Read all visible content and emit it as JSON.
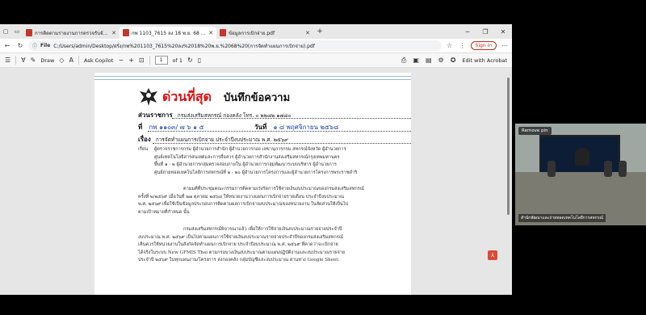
{
  "browser": {
    "tabs": [
      {
        "title": "การติดตามรายงานการตรวจรับจัดซื้อ/...",
        "active": false
      },
      {
        "title": "กพ 1103_7615 ลง 18 พ.ย. 68 (การเบิก...",
        "active": true
      },
      {
        "title": "ข้อมูลการเบิกจ่าย.pdf",
        "active": false
      }
    ],
    "new_tab": "+",
    "address": {
      "label": "File",
      "url": "C:/Users/admin/Desktop/ฝรั่ง/กพ%201103_7615%20ลง%2018%20พ.ย.%2068%20(การจัดทำแผนการเบิกจ่าย).pdf",
      "sign_in": "Sign in"
    }
  },
  "pdf_toolbar": {
    "draw": "Draw",
    "copilot": "Ask Copilot",
    "page_current": "1",
    "page_total": "of 1",
    "edit_acrobat": "Edit with Acrobat"
  },
  "document": {
    "urgent": "ด่วนที่สุด",
    "memo_title": "บันทึกข้อความ",
    "dept_label": "ส่วนราชการ",
    "dept_value": "กรมส่งเสริมสหกรณ์  กองคลัง  โทร. ๐ ๒๒๘๒ ๑๗๘๐",
    "ref_label": "ที่",
    "ref_value": "กพ ๑๑๐๓/  ๗ ๖ ๑ ๕",
    "date_label": "วันที่",
    "date_value": "๑ ๘   พฤศจิกายน  ๒๕๖๘",
    "subject_label": "เรื่อง",
    "subject_value": "การจัดทำแผนการเบิกจ่าย ประจำปีงบประมาณ พ.ศ. ๒๕๖๙",
    "salutation": "เรียน",
    "paragraph1": [
      "ผู้ตรวจราชการกรม ผู้อำนวยการสำนัก ผู้อำนวยการกอง เลขานุการกรม สหกรณ์จังหวัด ผู้อำนวยการ",
      "ศูนย์เทคโนโลยีสารสนเทศและการสื่อสาร ผู้อำนวยการสำนักงานส่งเสริมสหกรณ์กรุงเทพมหานคร",
      "พื้นที่ ๑ - ๒ ผู้อำนวยการกลุ่มตรวจสอบภายใน ผู้อำนวยการกลุ่มพัฒนาระบบบริหาร ผู้อำนวยการ",
      "ศูนย์ถ่ายทอดเทคโนโลยีการสหกรณ์ที่ ๑ - ๒๐ ผู้อำนวยการโครงการและผู้อำนวยการโครงการพระราชดำริ"
    ],
    "paragraph2": [
      "ตามมติที่ประชุมคณะกรรมการติดตามเร่งรัดการใช้จ่ายเงินงบประมาณของกรมส่งเสริมสหกรณ์",
      "ครั้งที่ ๒/๒๕๖๙ เมื่อวันที่ ๒๗ ตุลาคม ๒๕๖๘ ให้หน่วยงานวางแผนการเบิกจ่ายรายเดือน ประจำปีงบประมาณ",
      "พ.ศ. ๒๕๖๙ เพื่อใช้เป็นข้อมูลประกอบการติดตามผลการเบิกจ่ายงบประมาณของหน่วยงาน ในสัดส่วนให้เป็นไป",
      "ตามเป้าหมายที่กำหนด นั้น"
    ],
    "paragraph3": [
      "กรมส่งเสริมสหกรณ์พิจารณาแล้ว เพื่อให้การใช้จ่ายเงินงบประมาณรายจ่ายประจำปี",
      "งบประมาณ พ.ศ. ๒๕๖๙ เป็นไปตามแผนการใช้จ่ายเงินงบประมาณรายจ่ายประจำปีของกรมส่งเสริมสหกรณ์",
      "เห็นควรให้หน่วยงานในสังกัดจัดทำแผนการเบิกจ่าย ประจำปีงบประมาณ พ.ศ. ๒๕๖๙ ที่คาดว่าจะเบิกจ่าย",
      "ได้จริงในระบบ New GFMIS Thai ตามกรอบวงเงินงบประมาณตามแผนปฏิบัติงานและงบประมาณรายจ่าย",
      "ประจำปี ๒๕๖๙ ในทุกแผนงาน/โครงการ ส่งกองคลัง กลุ่มบัญชีและงบประมาณ ผ่านทาง Google Sheet:"
    ]
  },
  "video": {
    "remove_pin": "Remove pin",
    "participant": "สำนักพัฒนาและถ่ายทอดเทคโนโลยีการสหกรณ์"
  }
}
